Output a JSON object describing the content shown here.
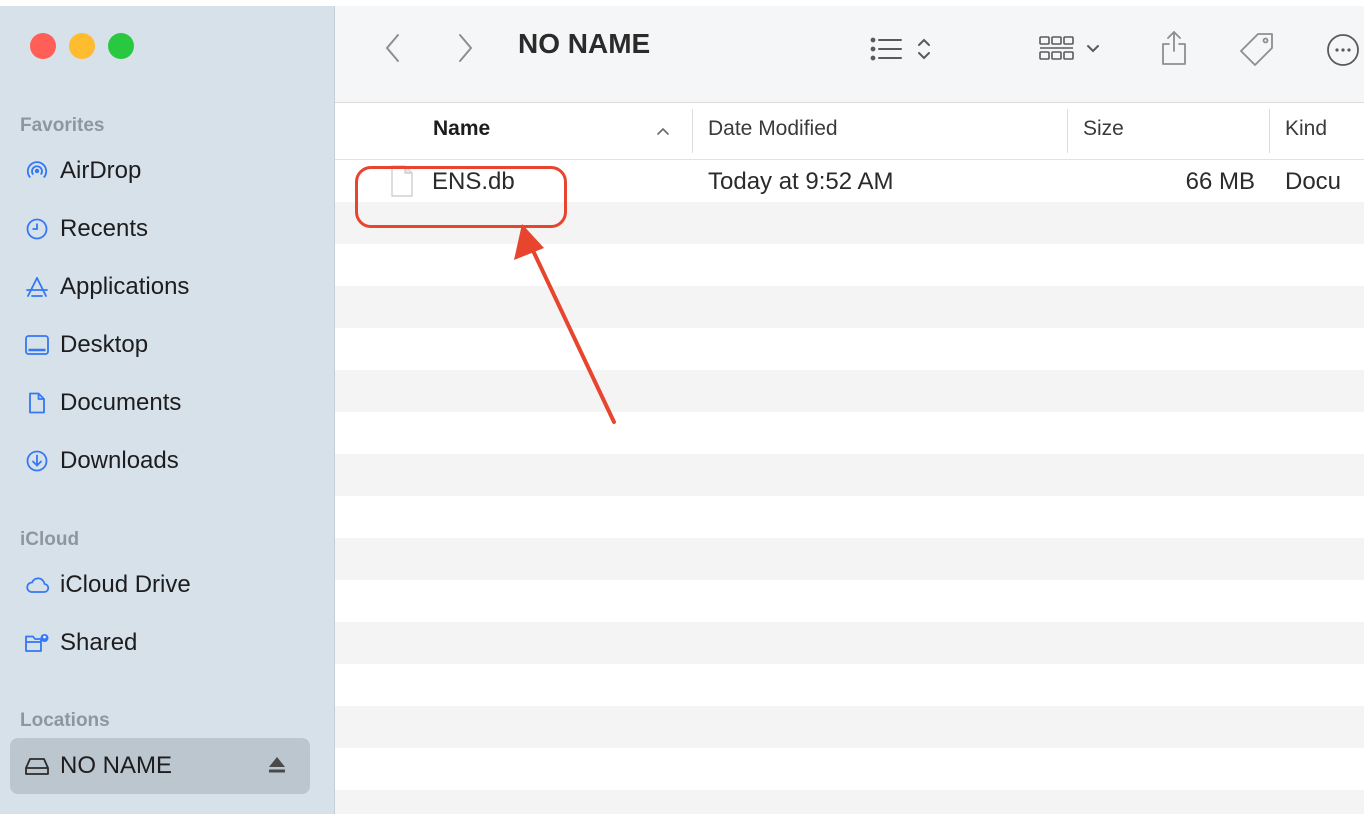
{
  "window": {
    "title": "NO NAME"
  },
  "sidebar": {
    "sections": [
      {
        "header": "Favorites",
        "items": [
          {
            "label": "AirDrop",
            "icon": "airdrop-icon"
          },
          {
            "label": "Recents",
            "icon": "clock-icon"
          },
          {
            "label": "Applications",
            "icon": "applications-icon"
          },
          {
            "label": "Desktop",
            "icon": "desktop-icon"
          },
          {
            "label": "Documents",
            "icon": "document-icon"
          },
          {
            "label": "Downloads",
            "icon": "download-icon"
          }
        ]
      },
      {
        "header": "iCloud",
        "items": [
          {
            "label": "iCloud Drive",
            "icon": "cloud-icon"
          },
          {
            "label": "Shared",
            "icon": "shared-folder-icon"
          }
        ]
      },
      {
        "header": "Locations",
        "items": [
          {
            "label": "NO NAME",
            "icon": "drive-icon",
            "selected": true
          }
        ]
      }
    ]
  },
  "columns": {
    "name": "Name",
    "date_modified": "Date Modified",
    "size": "Size",
    "kind": "Kind"
  },
  "files": [
    {
      "name": "ENS.db",
      "date_modified": "Today at 9:52 AM",
      "size": "66 MB",
      "kind": "Docu"
    }
  ],
  "colors": {
    "sidebar_bg": "#d7e1e9",
    "selected_bg": "#bcc6ce",
    "annotation": "#e8452e",
    "close": "#ff5f57",
    "minimize": "#febc2e",
    "maximize": "#28c840"
  }
}
